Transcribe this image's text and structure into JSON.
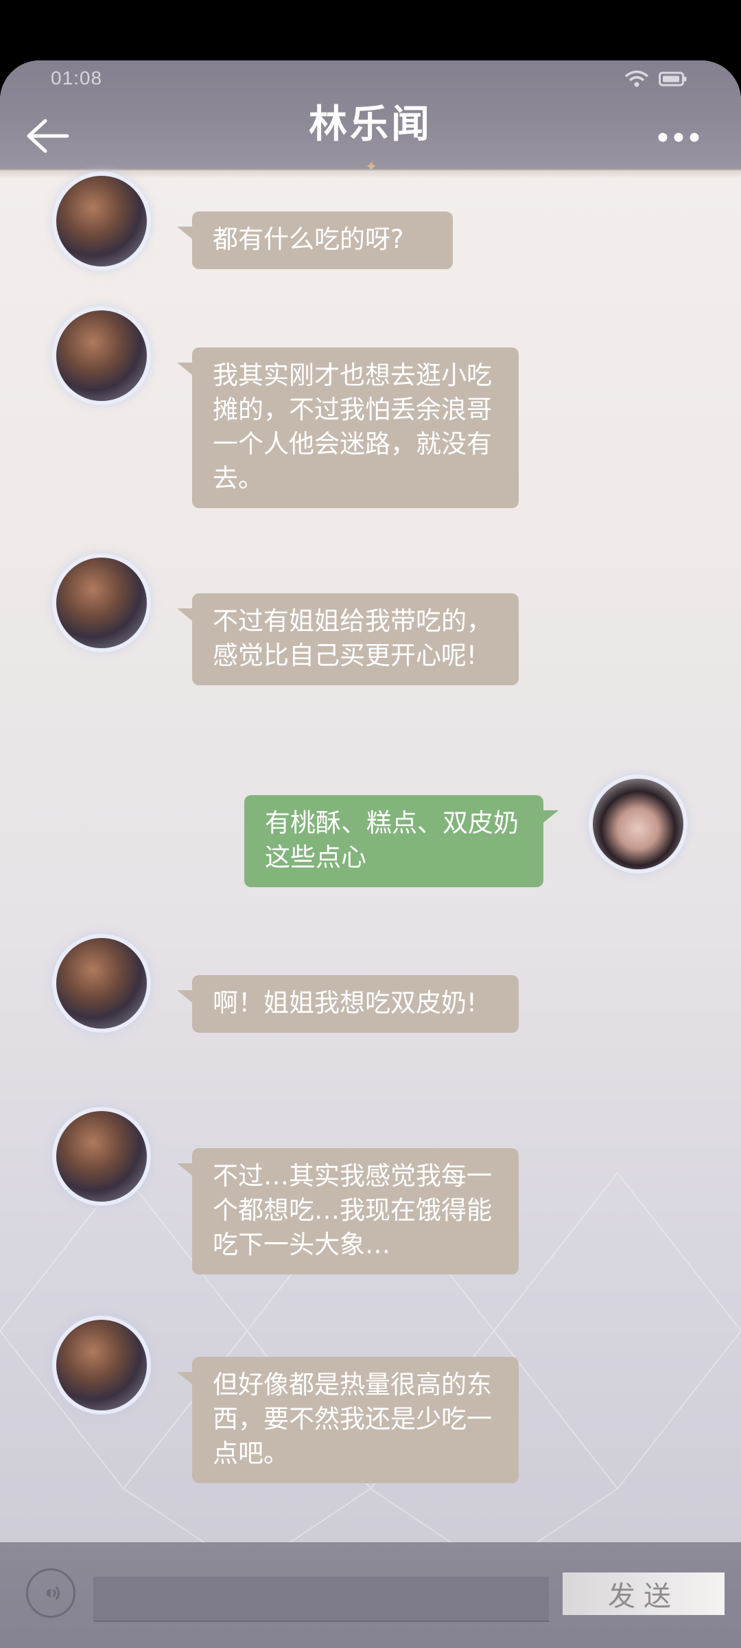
{
  "status_bar": {
    "time": "01:08"
  },
  "header": {
    "title": "林乐闻"
  },
  "messages": [
    {
      "side": "in",
      "text": "都有什么吃的呀?"
    },
    {
      "side": "in",
      "text": "我其实刚才也想去逛小吃摊的，不过我怕丢余浪哥一个人他会迷路，就没有去。"
    },
    {
      "side": "in",
      "text": "不过有姐姐给我带吃的，感觉比自己买更开心呢!"
    },
    {
      "side": "out",
      "text": "有桃酥、糕点、双皮奶这些点心"
    },
    {
      "side": "in",
      "text": "啊！姐姐我想吃双皮奶!"
    },
    {
      "side": "in",
      "text": "不过…其实我感觉我每一个都想吃…我现在饿得能吃下一头大象…"
    },
    {
      "side": "in",
      "text": "但好像都是热量很高的东西，要不然我还是少吃一点吧。"
    }
  ],
  "input": {
    "placeholder": ""
  },
  "send_button": {
    "label": "发送"
  },
  "colors": {
    "header": "#8a8696",
    "incoming_bubble": "#c5b9ae",
    "outgoing_bubble": "#82b47c",
    "bottom_bar": "#8a8796"
  },
  "icons": [
    "back-arrow-icon",
    "wifi-icon",
    "battery-icon",
    "more-dots-icon",
    "voice-icon"
  ]
}
